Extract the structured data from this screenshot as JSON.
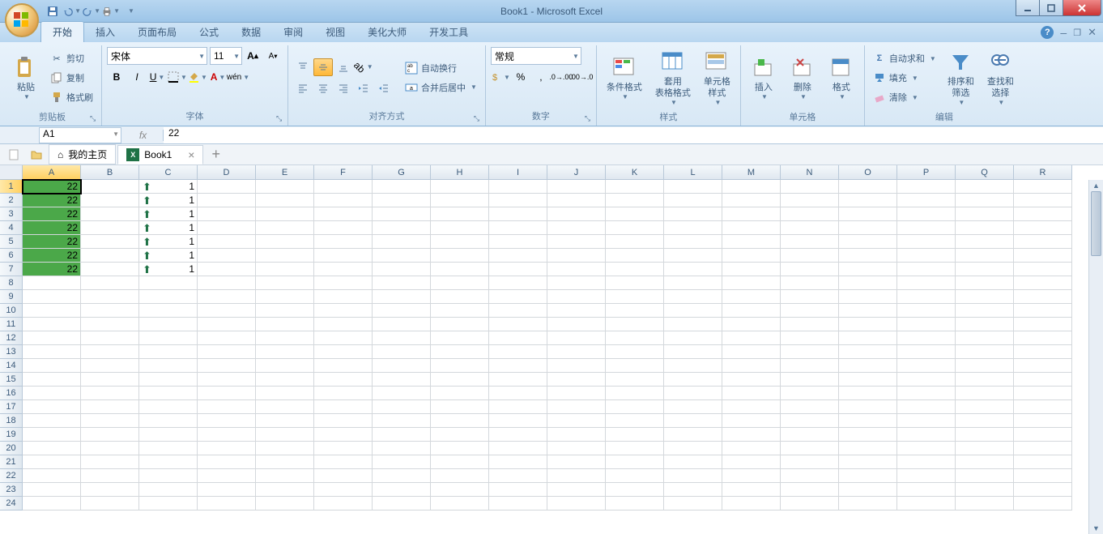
{
  "window": {
    "title": "Book1 - Microsoft Excel"
  },
  "tabs": {
    "items": [
      "开始",
      "插入",
      "页面布局",
      "公式",
      "数据",
      "审阅",
      "视图",
      "美化大师",
      "开发工具"
    ],
    "active": 0
  },
  "ribbon": {
    "clipboard": {
      "label": "剪贴板",
      "paste": "粘贴",
      "cut": "剪切",
      "copy": "复制",
      "format_painter": "格式刷"
    },
    "font": {
      "label": "字体",
      "name": "宋体",
      "size": "11"
    },
    "alignment": {
      "label": "对齐方式",
      "wrap": "自动换行",
      "merge": "合并后居中"
    },
    "number": {
      "label": "数字",
      "format": "常规"
    },
    "styles": {
      "label": "样式",
      "conditional": "条件格式",
      "table": "套用\n表格格式",
      "cell": "单元格\n样式"
    },
    "cells": {
      "label": "单元格",
      "insert": "插入",
      "delete": "删除",
      "format": "格式"
    },
    "editing": {
      "label": "编辑",
      "autosum": "自动求和",
      "fill": "填充",
      "clear": "清除",
      "sort": "排序和\n筛选",
      "find": "查找和\n选择"
    }
  },
  "formula_bar": {
    "name_box": "A1",
    "fx": "fx",
    "value": "22"
  },
  "doc_tabs": {
    "home": "我的主页",
    "book": "Book1"
  },
  "grid": {
    "columns": [
      "A",
      "B",
      "C",
      "D",
      "E",
      "F",
      "G",
      "H",
      "I",
      "J",
      "K",
      "L",
      "M",
      "N",
      "O",
      "P",
      "Q",
      "R"
    ],
    "rows_visible": 24,
    "selected_cell": "A1",
    "data": [
      {
        "row": 1,
        "A": "22",
        "C": "1"
      },
      {
        "row": 2,
        "A": "22",
        "C": "1"
      },
      {
        "row": 3,
        "A": "22",
        "C": "1"
      },
      {
        "row": 4,
        "A": "22",
        "C": "1"
      },
      {
        "row": 5,
        "A": "22",
        "C": "1"
      },
      {
        "row": 6,
        "A": "22",
        "C": "1"
      },
      {
        "row": 7,
        "A": "22",
        "C": "1"
      }
    ]
  }
}
